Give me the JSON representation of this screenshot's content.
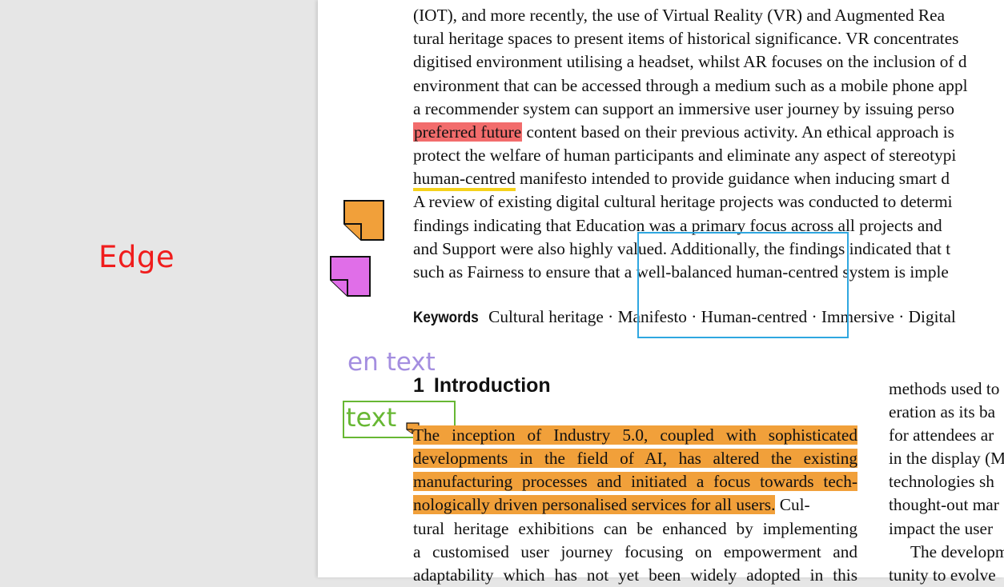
{
  "sidebar": {
    "edge_label": "Edge"
  },
  "annotations": {
    "purple_label": "en text",
    "green_label": "text",
    "colors": {
      "red_highlight": "#f26c6c",
      "orange_highlight": "#f1a03a",
      "yellow_underline": "#f5d21b",
      "blue_box": "#2fa7e0",
      "green_box": "#67b733",
      "orange_note": "#f1a03a",
      "magenta_note": "#e06ee8"
    }
  },
  "abstract": {
    "l1": "(IOT), and more recently, the use of Virtual Reality (VR) and Augmented Rea",
    "l2": "tural heritage spaces to present items of historical significance. VR concentrates",
    "l3": "digitised environment utilising a headset, whilst AR focuses on the inclusion of d",
    "l4": "environment that can be accessed through a medium such as a mobile phone appl",
    "l5": "a recommender system can support an immersive user journey by issuing perso",
    "l6_highlight": "preferred future",
    "l6_rest": " content based on their previous activity. An ethical approach is",
    "l7": "protect the welfare of human participants and eliminate any aspect of stereotypi",
    "l8_underline": "human-centred",
    "l8_rest": " manifesto intended to provide guidance when inducing smart d",
    "l9": "A review of existing digital cultural heritage projects was conducted to determi",
    "l10": "findings indicating that Education was a primary focus across all projects and",
    "l11": "and Support were also highly valued. Additionally, the findings indicated that t",
    "l12": "such as Fairness to ensure that a well-balanced human-centred system is imple"
  },
  "keywords": {
    "label": "Keywords",
    "text": "Cultural heritage · Manifesto · Human-centred · Immersive · Digital"
  },
  "section": {
    "number": "1",
    "title": "Introduction"
  },
  "intro_left": {
    "l1": "The inception of Industry 5.0, coupled with sophisticated",
    "l2": "developments in the field of AI, has altered the existing",
    "l3": "manufacturing processes and initiated a focus towards tech-",
    "l4_highlight": "nologically driven personalised services for all users.",
    "l4_rest": " Cul-",
    "l5": "tural heritage exhibitions can be enhanced by implementing",
    "l6": "a customised user journey focusing on empowerment and",
    "l7": "adaptability which has not yet been widely adopted in this"
  },
  "intro_right": {
    "l1": "methods used to",
    "l2": "eration as its ba",
    "l3": "for attendees ar",
    "l4": "in the display (M",
    "l5": "technologies sh",
    "l6": "thought-out mar",
    "l7": "impact the user",
    "l8": "The developm",
    "l9": "tunity to evolve"
  }
}
